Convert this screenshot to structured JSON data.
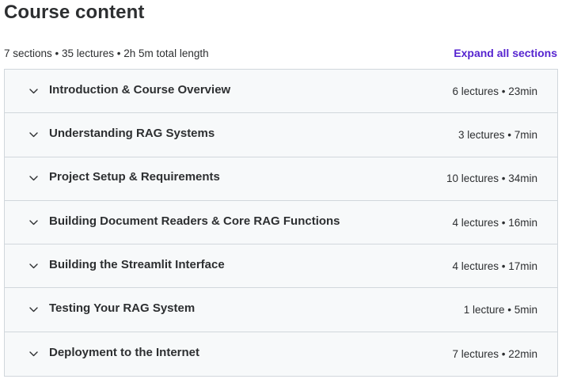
{
  "header": {
    "title": "Course content",
    "summary": "7 sections • 35 lectures • 2h 5m total length",
    "expand_all_label": "Expand all sections"
  },
  "icons": {
    "chevron": "chevron-down-icon"
  },
  "colors": {
    "accent": "#5624d0",
    "section_bg": "#f7f9fa",
    "border": "#d1d7dc",
    "text": "#2d2f31"
  },
  "sections": [
    {
      "title": "Introduction & Course Overview",
      "meta": "6 lectures • 23min"
    },
    {
      "title": "Understanding RAG Systems",
      "meta": "3 lectures • 7min"
    },
    {
      "title": "Project Setup & Requirements",
      "meta": "10 lectures • 34min"
    },
    {
      "title": "Building Document Readers & Core RAG Functions",
      "meta": "4 lectures • 16min"
    },
    {
      "title": "Building the Streamlit Interface",
      "meta": "4 lectures • 17min"
    },
    {
      "title": "Testing Your RAG System",
      "meta": "1 lecture • 5min"
    },
    {
      "title": "Deployment to the Internet",
      "meta": "7 lectures • 22min"
    }
  ]
}
